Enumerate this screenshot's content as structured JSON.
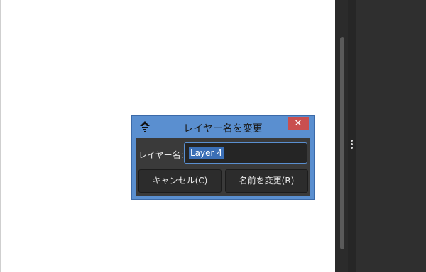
{
  "dialog": {
    "title": "レイヤー名を変更",
    "close_symbol": "✕",
    "field_label": "レイヤー名:",
    "field_value": "Layer 4",
    "cancel_label": "キャンセル(C)",
    "rename_label": "名前を変更(R)"
  },
  "icons": {
    "app": "inkscape-icon",
    "close": "close-icon",
    "grip": "panel-grip-icon"
  },
  "colors": {
    "dialog_frame": "#5a8fd0",
    "close_button": "#c94f4f",
    "dialog_body": "#3a3a3a",
    "selection": "#3b6fb6"
  }
}
